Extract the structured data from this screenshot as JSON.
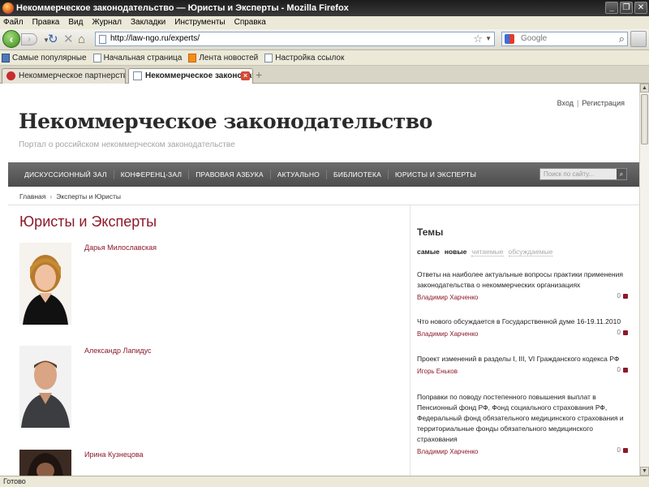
{
  "window": {
    "title": "Некоммерческое законодательство — Юристы и Эксперты - Mozilla Firefox"
  },
  "menu": [
    "Файл",
    "Правка",
    "Вид",
    "Журнал",
    "Закладки",
    "Инструменты",
    "Справка"
  ],
  "nav": {
    "url": "http://law-ngo.ru/experts/",
    "search_placeholder": "Google"
  },
  "bookmarks": [
    "Самые популярные",
    "Начальная страница",
    "Лента новостей",
    "Настройка ссылок"
  ],
  "tabs": [
    {
      "label": "Некоммерческое партнерство «Юрис...",
      "active": false
    },
    {
      "label": "Некоммерческое законодатель...",
      "active": true
    }
  ],
  "status": "Готово",
  "site": {
    "login": "Вход",
    "register": "Регистрация",
    "title": "Некоммерческое законодательство",
    "subtitle": "Портал о российском некоммерческом законодательстве",
    "nav": [
      "Дискуссионный зал",
      "Конференц-зал",
      "Правовая азбука",
      "Актуально",
      "Библиотека",
      "Юристы и эксперты"
    ],
    "search_placeholder": "Поиск по сайту...",
    "breadcrumb": [
      "Главная",
      "Эксперты и Юристы"
    ],
    "heading": "Юристы и Эксперты",
    "experts": [
      {
        "name": "Дарья Милославская"
      },
      {
        "name": "Александр Лапидус"
      },
      {
        "name": "Ирина Кузнецова"
      }
    ],
    "themes": {
      "title": "Темы",
      "filters": [
        {
          "label": "самые",
          "active": true
        },
        {
          "label": "новые",
          "active": true
        },
        {
          "label": "читаемые",
          "active": false
        },
        {
          "label": "обсуждаемые",
          "active": false
        }
      ],
      "items": [
        {
          "title": "Ответы на наиболее актуальные вопросы практики применения законодательства о некоммерческих организациях",
          "author": "Владимир Харченко",
          "count": "0"
        },
        {
          "title": "Что нового обсуждается в Государственной думе 16-19.11.2010",
          "author": "Владимир Харченко",
          "count": "0"
        },
        {
          "title": "Проект изменений в разделы I, III, VI Гражданского кодекса РФ",
          "author": "Игорь Еньков",
          "count": "0"
        },
        {
          "title": "Поправки по поводу постепенного повышения выплат в Пенсионный фонд РФ, Фонд социального страхования РФ, Федеральный фонд обязательного медицинского страхования и территориальные фонды обязательного медицинского страхования",
          "author": "Владимир Харченко",
          "count": "0"
        }
      ]
    }
  }
}
